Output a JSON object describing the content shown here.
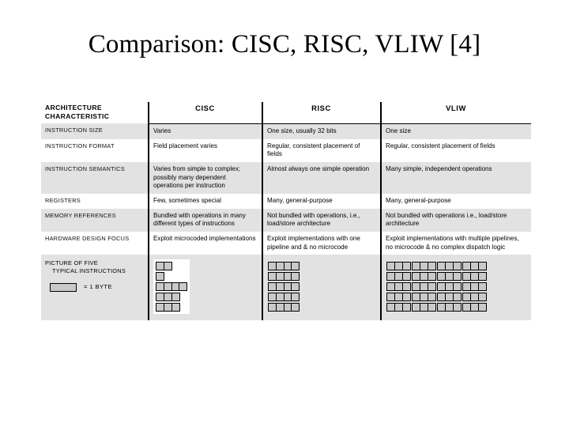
{
  "slide": {
    "title": "Comparison: CISC, RISC, VLIW [4]"
  },
  "table": {
    "headers": {
      "label_line1": "ARCHITECTURE",
      "label_line2": "CHARACTERISTIC",
      "cisc": "CISC",
      "risc": "RISC",
      "vliw": "VLIW"
    },
    "rows": [
      {
        "label": "INSTRUCTION SIZE",
        "cisc": "Varies",
        "risc": "One size, usually 32 bits",
        "vliw": "One size"
      },
      {
        "label": "INSTRUCTION FORMAT",
        "cisc": "Field placement varies",
        "risc": "Regular, consistent placement of fields",
        "vliw": "Regular, consistent placement of fields"
      },
      {
        "label": "INSTRUCTION SEMANTICS",
        "cisc": "Varies from simple to complex; possibly many dependent operations per instruction",
        "risc": "Almost always one simple operation",
        "vliw": "Many simple, independent operations"
      },
      {
        "label": "REGISTERS",
        "cisc": "Few, sometimes special",
        "risc": "Many, general-purpose",
        "vliw": "Many, general-purpose"
      },
      {
        "label": "MEMORY REFERENCES",
        "cisc": "Bundled with operations in many different types of instructions",
        "risc": "Not bundled with operations, i.e., load/store architecture",
        "vliw": "Not bundled with operations i.e., load/store architecture"
      },
      {
        "label": "HARDWARE DESIGN FOCUS",
        "cisc": "Exploit microcoded implementations",
        "risc": "Exploit implementations with one pipeline and & no microcode",
        "vliw": "Exploit implementations with multiple pipelines, no microcode & no complex dispatch logic"
      }
    ],
    "picture_row": {
      "label_line1": "PICTURE OF FIVE",
      "label_line2": "TYPICAL INSTRUCTIONS",
      "legend_text": "= 1 BYTE",
      "diagrams": {
        "cisc": {
          "instruction_byte_counts": [
            2,
            1,
            4,
            3,
            3
          ],
          "group_size": 0
        },
        "risc": {
          "instruction_byte_counts": [
            4,
            4,
            4,
            4,
            4
          ],
          "group_size": 0
        },
        "vliw": {
          "instruction_byte_counts": [
            12,
            12,
            12,
            12,
            12
          ],
          "group_size": 3
        }
      }
    }
  },
  "colors": {
    "band": "#e2e2e2",
    "byte_fill": "#c9c9c9",
    "rule": "#000000",
    "text": "#000000",
    "background": "#ffffff"
  }
}
